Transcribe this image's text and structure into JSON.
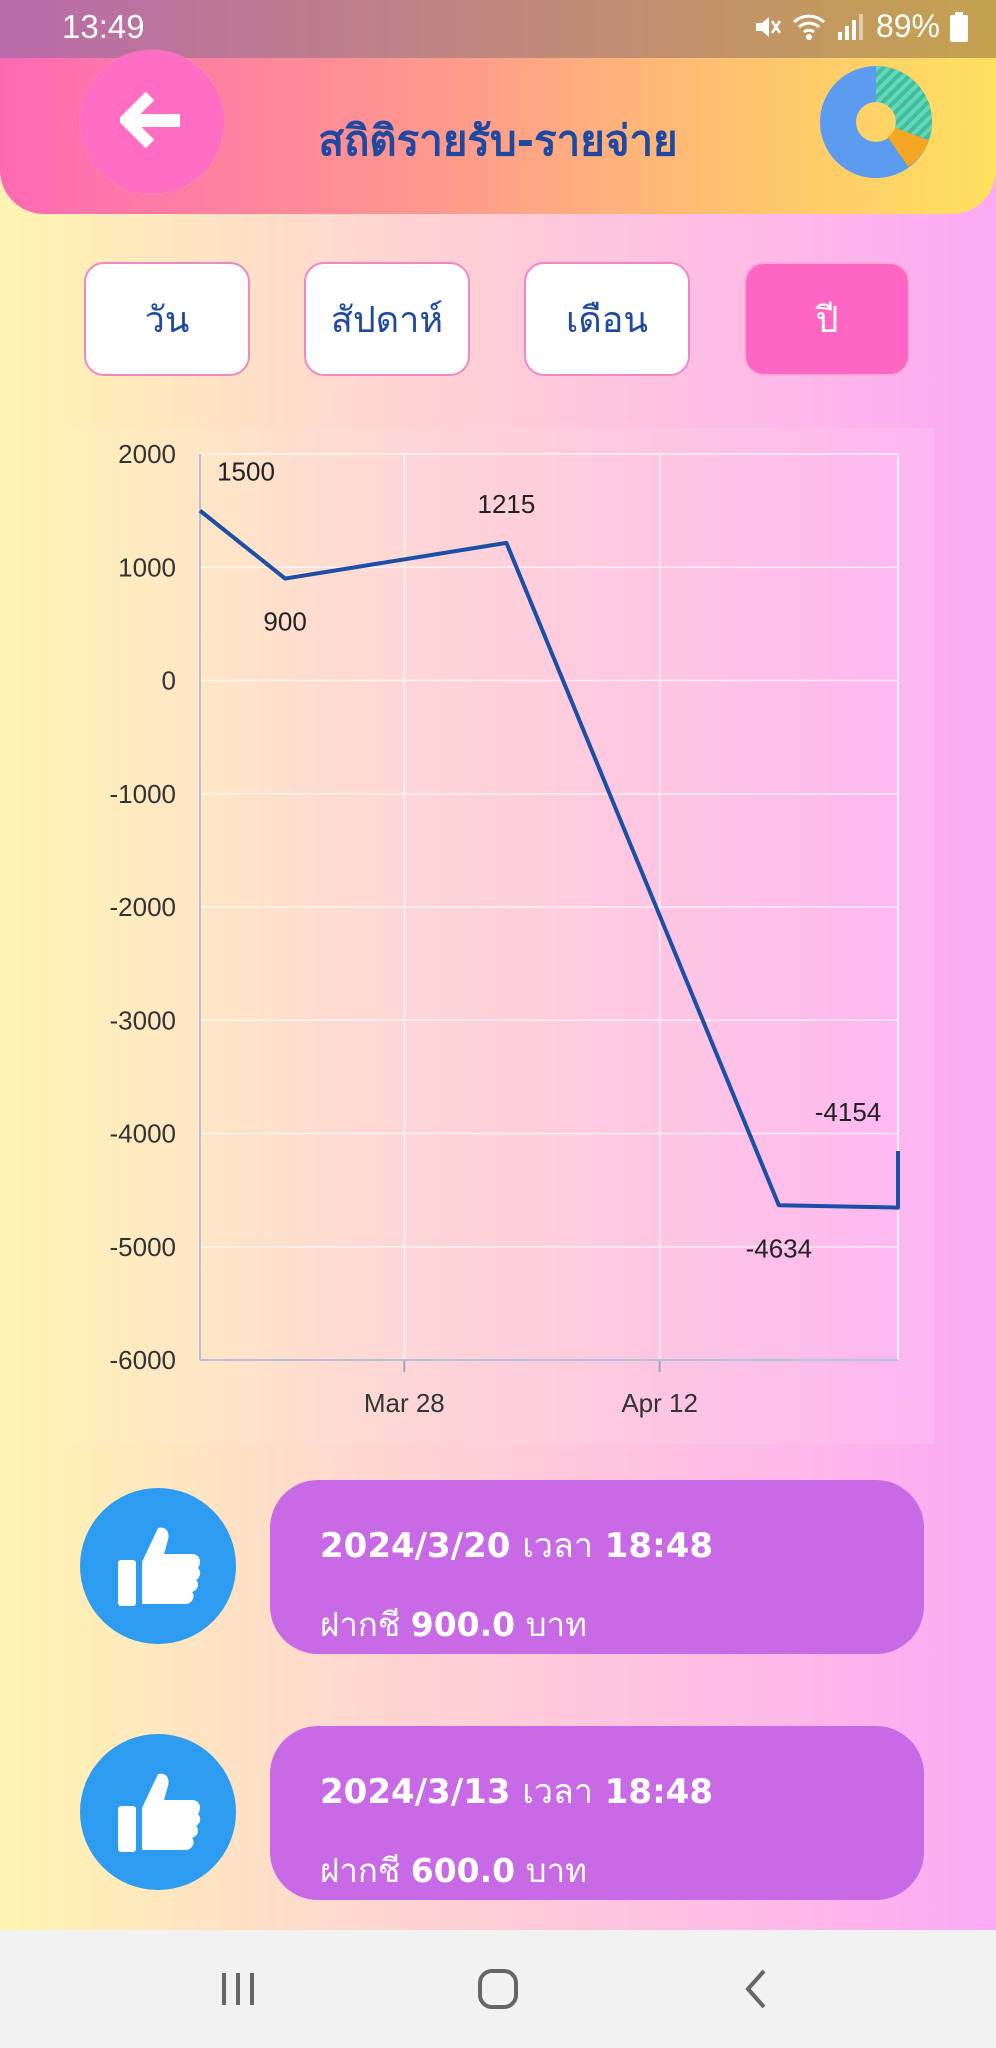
{
  "status_bar": {
    "time": "13:49",
    "battery": "89%"
  },
  "header": {
    "title": "สถิติรายรับ-รายจ่าย"
  },
  "tabs": [
    {
      "label": "วัน",
      "active": false
    },
    {
      "label": "สัปดาห์",
      "active": false
    },
    {
      "label": "เดือน",
      "active": false
    },
    {
      "label": "ปี",
      "active": true
    }
  ],
  "chart_data": {
    "type": "line",
    "x": [
      "2024-03-16",
      "2024-03-21",
      "2024-04-03",
      "2024-04-19",
      "2024-04-26",
      "2024-04-26"
    ],
    "y": [
      1500,
      900,
      1215,
      -4634,
      -4654,
      -4154
    ],
    "point_labels": [
      "1500",
      "900",
      "1215",
      "-4634",
      "",
      "-4154"
    ],
    "ylim": [
      -6000,
      2000
    ],
    "yticks": [
      "2000",
      "1000",
      "0",
      "-1000",
      "-2000",
      "-3000",
      "-4000",
      "-5000",
      "-6000"
    ],
    "xticks": [
      "Mar 28",
      "Apr 12"
    ],
    "grid": true,
    "line_color": "#1b4fa5"
  },
  "history": [
    {
      "date": "2024/3/20",
      "time_word": "เวลา",
      "time": "18:48",
      "type": "ฝากชี",
      "amount": "900.0",
      "unit": "บาท"
    },
    {
      "date": "2024/3/13",
      "time_word": "เวลา",
      "time": "18:48",
      "type": "ฝากชี",
      "amount": "600.0",
      "unit": "บาท"
    }
  ]
}
